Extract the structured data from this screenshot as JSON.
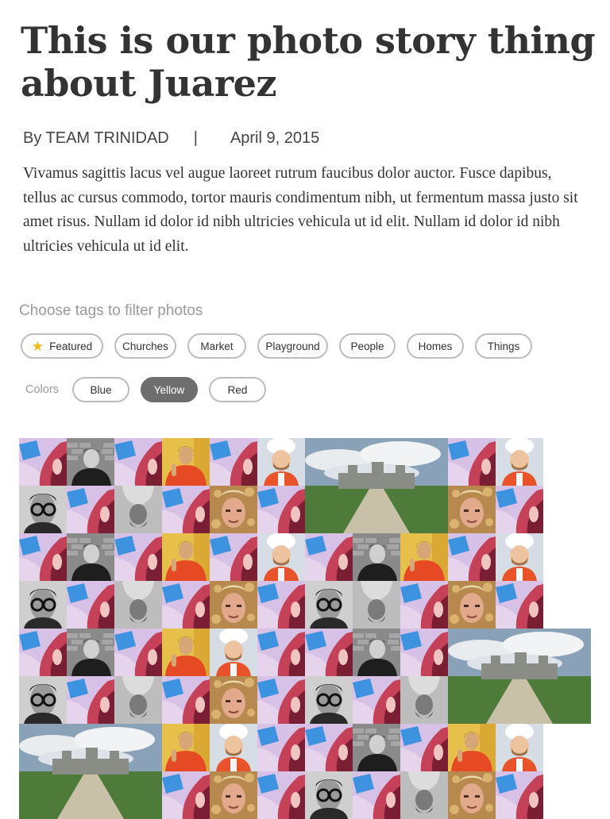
{
  "article": {
    "title": "This is our photo story thing about Juarez",
    "byline": "By TEAM TRINIDAD",
    "separator": "|",
    "date": "April 9, 2015",
    "intro": "Vivamus sagittis lacus vel augue laoreet rutrum faucibus dolor auctor. Fusce dapibus, tellus ac cursus commodo, tortor mauris condimentum nibh, ut fermentum massa justo sit amet risus. Nullam id dolor id nibh ultricies vehicula ut id elit. Nullam id dolor id nibh ultricies vehicula ut id elit."
  },
  "filters": {
    "heading": "Choose tags to filter photos",
    "tags": [
      {
        "label": "Featured",
        "icon": "star-icon"
      },
      {
        "label": "Churches"
      },
      {
        "label": "Market"
      },
      {
        "label": "Playground"
      },
      {
        "label": "People"
      },
      {
        "label": "Homes"
      },
      {
        "label": "Things"
      }
    ],
    "colors_label": "Colors",
    "colors": [
      {
        "label": "Blue",
        "selected": false
      },
      {
        "label": "Yellow",
        "selected": true
      },
      {
        "label": "Red",
        "selected": false
      }
    ]
  },
  "theme": {
    "text": "#333333",
    "muted": "#9a9a9a",
    "chip_border": "#bdbdbd",
    "chip_active": "#6e6e6e",
    "star": "#f3b912"
  },
  "photo_grid": {
    "tile_rows": [
      "phone,bw-man,phone,orange-man,phone,chef,castle,castle,orange-man,phone,chef",
      "glasses-man,phone,upside-down,phone,gold-man,phone,castle,castle,phone,gold-man,phone",
      "phone,bw-man,phone,orange-man,phone,chef,phone,bw-man,orange-man,phone,chef",
      "glasses-man,phone,upside-down,phone,gold-man,phone,glasses-man,upside-down,phone,gold-man,phone",
      "phone,bw-man,phone,orange-man,chef,phone,phone,bw-man,phone,castle,castle",
      "glasses-man,phone,upside-down,phone,gold-man,phone,glasses-man,phone,upside-down,castle,castle",
      "castle,castle,phone,orange-man,chef,phone,phone,bw-man,phone,orange-man,chef",
      "glasses-man,phone,upside-down,phone,gold-man,phone,glasses-man,phone,upside-down,gold-man,phone"
    ],
    "big_tiles": [
      {
        "photo": "castle",
        "row": 0,
        "col": 6,
        "size": 3
      },
      {
        "photo": "castle",
        "row": 4,
        "col": 9,
        "size": 3
      },
      {
        "photo": "castle",
        "row": 6,
        "col": 0,
        "size": 3
      }
    ],
    "photos": {
      "phone": "Woman with blue phone",
      "bw-man": "Man in black and white",
      "orange-man": "Man in orange hoodie",
      "chef": "Man in chef hat",
      "glasses-man": "Man with glasses",
      "upside-down": "Upside-down portrait",
      "gold-man": "Man against gold background",
      "castle": "Castle and tree-lined road"
    }
  }
}
